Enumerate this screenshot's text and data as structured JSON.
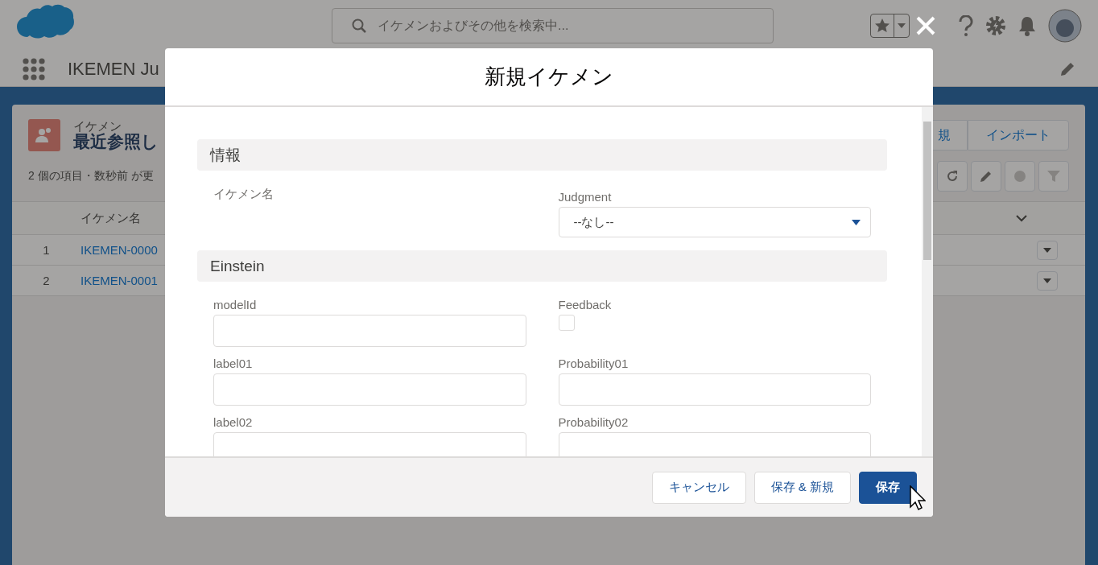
{
  "header": {
    "search_placeholder": "イケメンおよびその他を検索中..."
  },
  "nav": {
    "app_name": "IKEMEN Ju"
  },
  "list": {
    "object_label": "イケメン",
    "title": "最近参照し",
    "status": "2 個の項目・数秒前 が更",
    "buttons": [
      "規",
      "インポート"
    ],
    "columns": [
      "イケメン名"
    ],
    "rows": [
      {
        "number": "1",
        "name": "IKEMEN-0000"
      },
      {
        "number": "2",
        "name": "IKEMEN-0001"
      }
    ]
  },
  "modal": {
    "title": "新規イケメン",
    "sections": [
      {
        "title": "情報",
        "fields": [
          {
            "kind": "readonly",
            "label": "イケメン名"
          },
          {
            "kind": "select",
            "label": "Judgment",
            "value": "--なし--"
          }
        ]
      },
      {
        "title": "Einstein",
        "fields": [
          {
            "kind": "text",
            "label": "modelId"
          },
          {
            "kind": "checkbox",
            "label": "Feedback",
            "checked": false
          },
          {
            "kind": "text",
            "label": "label01"
          },
          {
            "kind": "text",
            "label": "Probability01"
          },
          {
            "kind": "text",
            "label": "label02"
          },
          {
            "kind": "text",
            "label": "Probability02"
          }
        ]
      }
    ],
    "buttons": [
      {
        "label": "キャンセル",
        "kind": "neutral"
      },
      {
        "label": "保存 & 新規",
        "kind": "neutral"
      },
      {
        "label": "保存",
        "kind": "brand"
      }
    ]
  }
}
